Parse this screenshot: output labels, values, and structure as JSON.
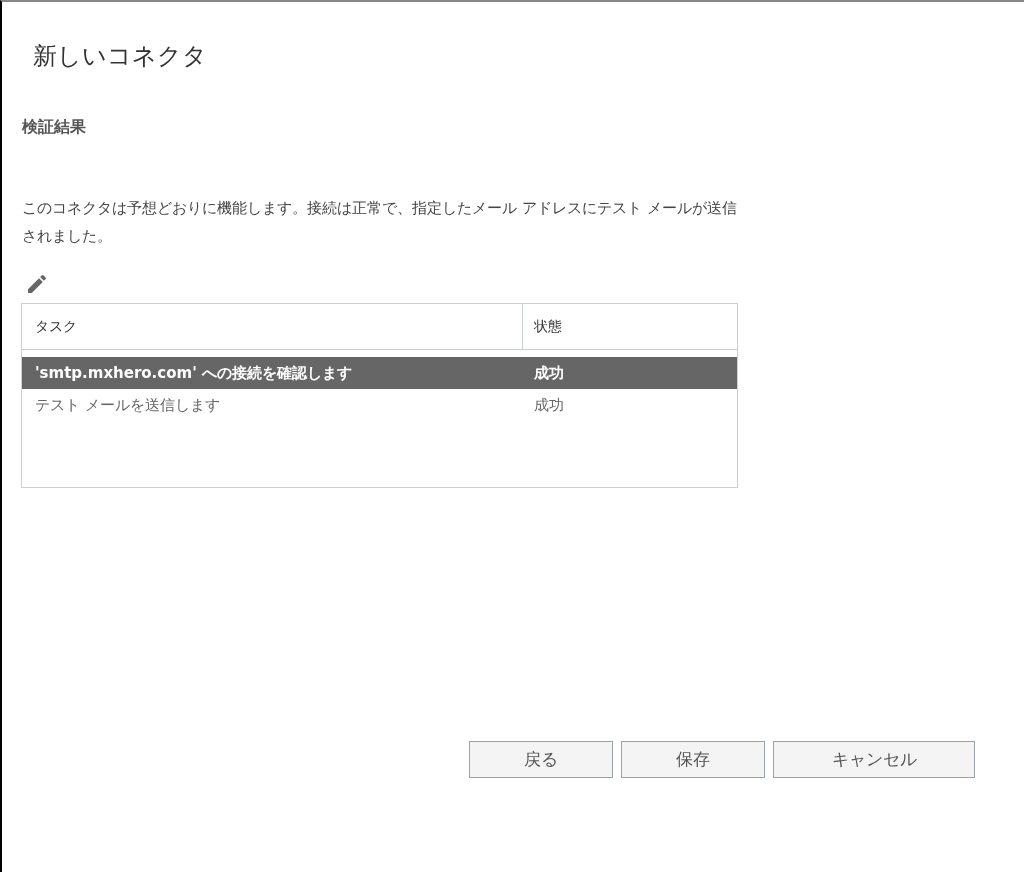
{
  "dialog": {
    "title": "新しいコネクタ"
  },
  "section": {
    "heading": "検証結果",
    "message": "このコネクタは予想どおりに機能します。接続は正常で、指定したメール アドレスにテスト メールが送信されました。"
  },
  "table": {
    "columns": [
      "タスク",
      "状態"
    ],
    "rows": [
      {
        "task": "'smtp.mxhero.com' への接続を確認します",
        "status": "成功",
        "selected": true
      },
      {
        "task": "テスト メールを送信します",
        "status": "成功",
        "selected": false
      }
    ]
  },
  "buttons": [
    {
      "label": "戻る"
    },
    {
      "label": "保存"
    },
    {
      "label": "キャンセル"
    }
  ]
}
